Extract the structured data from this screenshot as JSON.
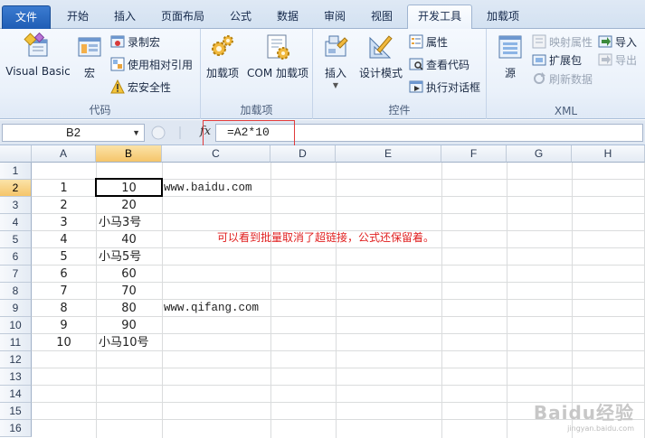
{
  "tabs": [
    {
      "label": "文件"
    },
    {
      "label": "开始"
    },
    {
      "label": "插入"
    },
    {
      "label": "页面布局"
    },
    {
      "label": "公式"
    },
    {
      "label": "数据"
    },
    {
      "label": "审阅"
    },
    {
      "label": "视图"
    },
    {
      "label": "开发工具"
    },
    {
      "label": "加载项"
    }
  ],
  "ribbon": {
    "code": {
      "label": "代码",
      "visual_basic": "Visual Basic",
      "macros": "宏",
      "record_macro": "录制宏",
      "relative_ref": "使用相对引用",
      "macro_security": "宏安全性"
    },
    "addins": {
      "label": "加载项",
      "addins_btn": "加载项",
      "com_addins": "COM 加载项"
    },
    "controls": {
      "label": "控件",
      "insert": "插入",
      "design_mode": "设计模式",
      "properties": "属性",
      "view_code": "查看代码",
      "run_dialog": "执行对话框"
    },
    "xml": {
      "label": "XML",
      "source": "源",
      "map_props": "映射属性",
      "expansion_packs": "扩展包",
      "refresh_data": "刷新数据",
      "import": "导入",
      "export": "导出"
    }
  },
  "formula_bar": {
    "name_box": "B2",
    "fx": "fx",
    "formula": "=A2*10"
  },
  "sheet": {
    "columns": [
      "A",
      "B",
      "C",
      "D",
      "E",
      "F",
      "G",
      "H"
    ],
    "rows": [
      "1",
      "2",
      "3",
      "4",
      "5",
      "6",
      "7",
      "8",
      "9",
      "10",
      "11",
      "12",
      "13",
      "14",
      "15",
      "16"
    ],
    "colA": [
      "1",
      "2",
      "3",
      "4",
      "5",
      "6",
      "7",
      "8",
      "9",
      "10"
    ],
    "colB": [
      "10",
      "20",
      "小马3号",
      "40",
      "小马5号",
      "60",
      "70",
      "80",
      "90",
      "小马10号"
    ],
    "c2": "www.baidu.com",
    "c9": "www.qifang.com",
    "note": "可以看到批量取消了超链接，公式还保留着。"
  },
  "watermark": {
    "brand": "Baidu经验",
    "url": "jingyan.baidu.com"
  },
  "colors": {
    "accent": "#1f5db5",
    "highlight_border": "#e03a3a",
    "note_text": "#e02020"
  }
}
